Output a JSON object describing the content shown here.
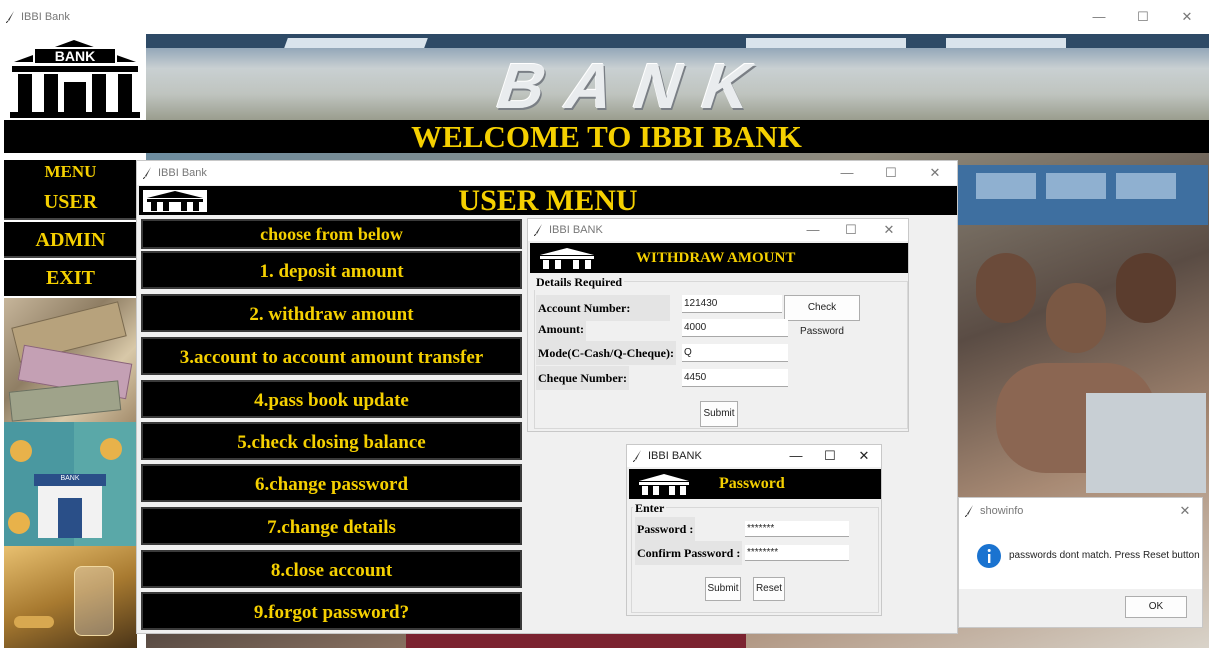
{
  "main_window": {
    "title": "IBBI Bank",
    "minimize": "—",
    "maximize": "☐",
    "close": "✕"
  },
  "banner": {
    "logo_text": "BANK",
    "title_text": "BANK"
  },
  "welcome": "WELCOME TO IBBI BANK",
  "sidebar": {
    "menu_label": "MENU",
    "user": "USER",
    "admin": "ADMIN",
    "exit": "EXIT",
    "bank_sign": "BANK"
  },
  "user_menu": {
    "title": "IBBI Bank",
    "header": "USER MENU",
    "prompt": "choose from below",
    "items": [
      "1. deposit amount",
      "2. withdraw amount",
      "3.account to account amount transfer",
      "4.pass book update",
      "5.check closing balance",
      "6.change password",
      "7.change details",
      "8.close account",
      "9.forgot password?"
    ]
  },
  "withdraw": {
    "title": "IBBI BANK",
    "header": "WITHDRAW AMOUNT",
    "legend": "Details Required",
    "account_label": "Account Number:",
    "account_value": "121430",
    "check_password": "Check Password",
    "amount_label": "Amount:",
    "amount_value": "4000",
    "mode_label": "Mode(C-Cash/Q-Cheque):",
    "mode_value": "Q",
    "cheque_label": "Cheque Number:",
    "cheque_value": "4450",
    "submit": "Submit"
  },
  "password": {
    "title": "IBBI BANK",
    "header": "Password",
    "legend": "Enter",
    "password_label": "Password :",
    "password_value": "*******",
    "confirm_label": "Confirm Password :",
    "confirm_value": "********",
    "submit": "Submit",
    "reset": "Reset"
  },
  "showinfo": {
    "title": "showinfo",
    "message": "passwords dont match. Press Reset button",
    "ok": "OK",
    "close": "✕"
  },
  "colors": {
    "gold": "#f5d000",
    "black": "#000000",
    "info_blue": "#1a73d0"
  }
}
